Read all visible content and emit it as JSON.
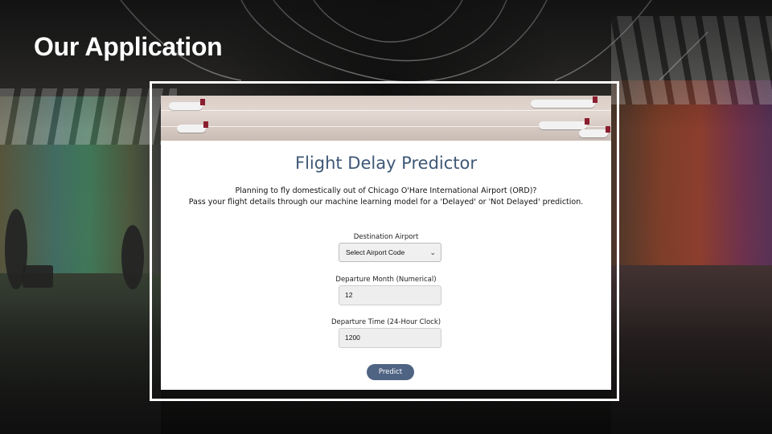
{
  "slide": {
    "title": "Our Application"
  },
  "app": {
    "title": "Flight Delay Predictor",
    "intro_line1": "Planning to fly domestically out of Chicago O'Hare International Airport (ORD)?",
    "intro_line2": "Pass your flight details through our machine learning model for a 'Delayed' or 'Not Delayed' prediction.",
    "destination": {
      "label": "Destination Airport",
      "selected": "Select Airport Code"
    },
    "month": {
      "label": "Departure Month (Numerical)",
      "value": "12"
    },
    "time": {
      "label": "Departure Time (24-Hour Clock)",
      "value": "1200"
    },
    "predict_label": "Predict"
  },
  "colors": {
    "title_blue": "#3f5876",
    "button": "#4f6383"
  }
}
